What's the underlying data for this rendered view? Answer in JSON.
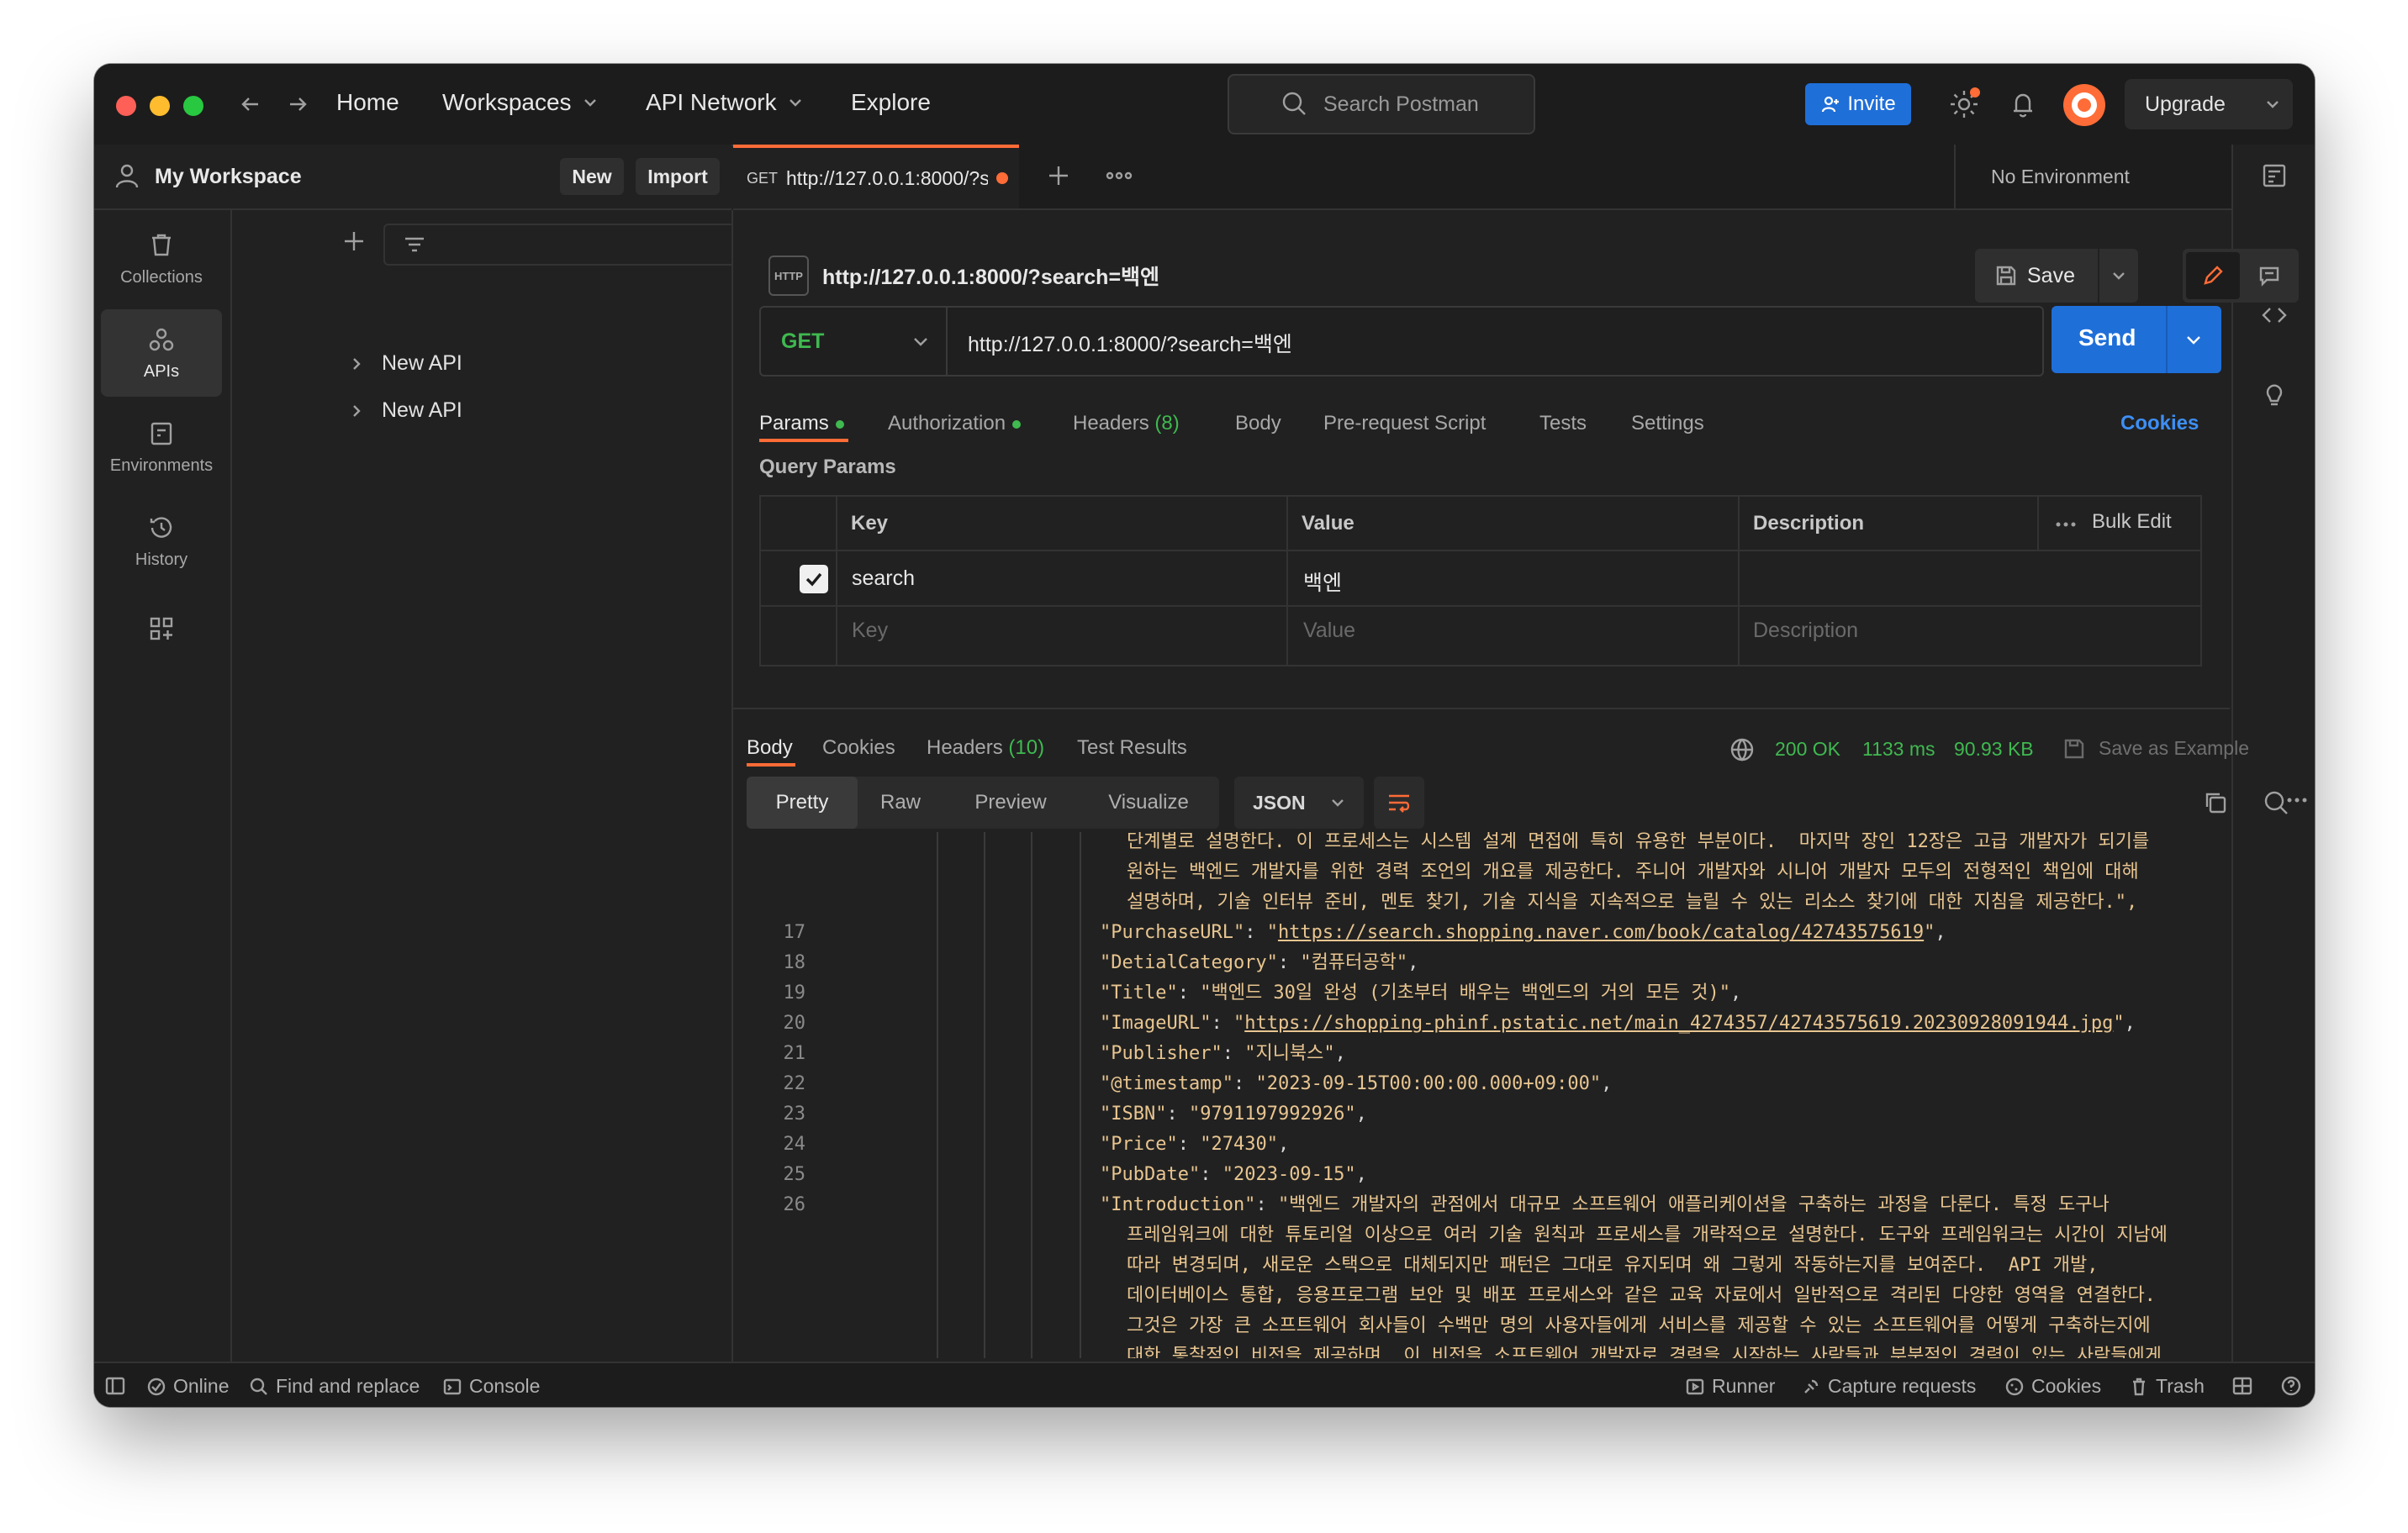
{
  "topbar": {
    "nav": [
      "Home",
      "Workspaces",
      "API Network",
      "Explore"
    ],
    "search_placeholder": "Search Postman",
    "invite_label": "Invite",
    "upgrade_label": "Upgrade"
  },
  "workspace": {
    "title": "My Workspace",
    "new_label": "New",
    "import_label": "Import"
  },
  "rail": [
    {
      "label": "Collections",
      "icon": "trash-can-icon"
    },
    {
      "label": "APIs",
      "icon": "apis-icon"
    },
    {
      "label": "Environments",
      "icon": "environment-icon"
    },
    {
      "label": "History",
      "icon": "history-icon"
    },
    {
      "label": "",
      "icon": "configure-grid-icon"
    }
  ],
  "tree": [
    "New API",
    "New API"
  ],
  "request_tab": {
    "method": "GET",
    "title": "http://127.0.0.1:8000/?s"
  },
  "environment": "No Environment",
  "request": {
    "name": "http://127.0.0.1:8000/?search=백엔",
    "save_label": "Save",
    "method": "GET",
    "url": "http://127.0.0.1:8000/?search=백엔",
    "send_label": "Send"
  },
  "req_tabs": {
    "params": "Params",
    "authorization": "Authorization",
    "headers": "Headers",
    "headers_count": "(8)",
    "body": "Body",
    "prerequest": "Pre-request Script",
    "tests": "Tests",
    "settings": "Settings",
    "cookies": "Cookies"
  },
  "query_params": {
    "title": "Query Params",
    "headers": [
      "Key",
      "Value",
      "Description"
    ],
    "bulk_edit": "Bulk Edit",
    "rows": [
      {
        "key": "search",
        "value": "백엔",
        "description": "",
        "checked": true
      }
    ],
    "placeholder": {
      "key": "Key",
      "value": "Value",
      "description": "Description"
    }
  },
  "response_tabs": {
    "body": "Body",
    "cookies": "Cookies",
    "headers": "Headers",
    "headers_count": "(10)",
    "tests": "Test Results",
    "status": "200 OK",
    "time": "1133 ms",
    "size": "90.93 KB",
    "save_example": "Save as Example"
  },
  "view_modes": {
    "pretty": "Pretty",
    "raw": "Raw",
    "preview": "Preview",
    "visualize": "Visualize",
    "format": "JSON"
  },
  "code_lines": {
    "pre": [
      "단계별로 설명한다. 이 프로세스는 시스템 설계 면접에 특히 유용한 부분이다.  마지막 장인 12장은 고급 개발자가 되기를",
      "원하는 백엔드 개발자를 위한 경력 조언의 개요를 제공한다. 주니어 개발자와 시니어 개발자 모두의 전형적인 책임에 대해",
      "설명하며, 기술 인터뷰 준비, 멘토 찾기, 기술 지식을 지속적으로 늘릴 수 있는 리소스 찾기에 대한 지침을 제공한다.\","
    ],
    "numbered": [
      {
        "n": "17",
        "k": "PurchaseURL",
        "v": "https://search.shopping.naver.com/book/catalog/42743575619",
        "link": true
      },
      {
        "n": "18",
        "k": "DetialCategory",
        "v": "컴퓨터공학",
        "link": false
      },
      {
        "n": "19",
        "k": "Title",
        "v": "백엔드 30일 완성 (기초부터 배우는 백엔드의 거의 모든 것)",
        "link": false
      },
      {
        "n": "20",
        "k": "ImageURL",
        "v": "https://shopping-phinf.pstatic.net/main_4274357/42743575619.20230928091944.jpg",
        "link": true
      },
      {
        "n": "21",
        "k": "Publisher",
        "v": "지니북스",
        "link": false
      },
      {
        "n": "22",
        "k": "@timestamp",
        "v": "2023-09-15T00:00:00.000+09:00",
        "link": false
      },
      {
        "n": "23",
        "k": "ISBN",
        "v": "9791197992926",
        "link": false
      },
      {
        "n": "24",
        "k": "Price",
        "v": "27430",
        "link": false
      },
      {
        "n": "25",
        "k": "PubDate",
        "v": "2023-09-15",
        "link": false
      }
    ],
    "intro_num": "26",
    "intro_key": "Introduction",
    "intro_first": "백엔드 개발자의 관점에서 대규모 소프트웨어 애플리케이션을 구축하는 과정을 다룬다. 특정 도구나",
    "intro_cont": [
      "프레임워크에 대한 튜토리얼 이상으로 여러 기술 원칙과 프로세스를 개략적으로 설명한다. 도구와 프레임워크는 시간이 지남에",
      "따라 변경되며, 새로운 스택으로 대체되지만 패턴은 그대로 유지되며 왜 그렇게 작동하는지를 보여준다.  API 개발,",
      "데이터베이스 통합, 응용프로그램 보안 및 배포 프로세스와 같은 교육 자료에서 일반적으로 격리된 다양한 영역을 연결한다.",
      "그것은 가장 큰 소프트웨어 회사들이 수백만 명의 사용자들에게 서비스를 제공할 수 있는 소프트웨어를 어떻게 구축하는지에",
      "대한 통찰적인 비전을 제공하며, 이 비전을 소프트웨어 개발자로 경력을 시작하는 사람들과 부분적인 경력이 있는 사람들에게"
    ]
  },
  "statusbar": {
    "online": "Online",
    "find_replace": "Find and replace",
    "console": "Console",
    "runner": "Runner",
    "capture": "Capture requests",
    "cookies": "Cookies",
    "trash": "Trash"
  },
  "colors": {
    "accent": "#1f6fd9",
    "brand_orange": "#ff6c37",
    "status_green": "#3fb950",
    "json_value": "#e8c590"
  }
}
